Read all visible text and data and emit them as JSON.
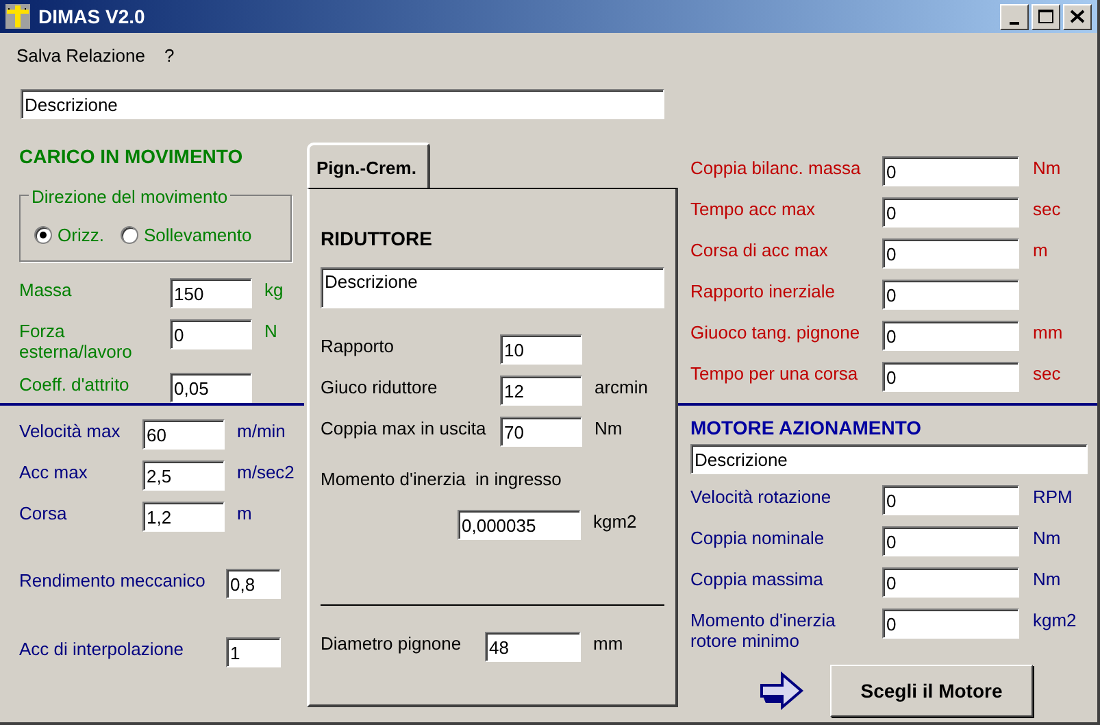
{
  "window": {
    "title": "DIMAS V2.0"
  },
  "menu": [
    {
      "label": "Salva Relazione"
    },
    {
      "label": "?"
    }
  ],
  "description": {
    "value": "Descrizione"
  },
  "load": {
    "heading": "CARICO IN MOVIMENTO",
    "direction": {
      "legend": "Direzione del movimento",
      "options": [
        {
          "label": "Orizz.",
          "selected": true
        },
        {
          "label": "Sollevamento",
          "selected": false
        }
      ]
    },
    "fields": [
      {
        "label": "Massa",
        "value": "150",
        "unit": "kg"
      },
      {
        "label": "Forza esterna/lavoro",
        "value": "0",
        "unit": "N"
      },
      {
        "label": "Coeff. d'attrito",
        "value": "0,05"
      }
    ]
  },
  "motion": {
    "fields": [
      {
        "label": "Velocità max",
        "value": "60",
        "unit": "m/min"
      },
      {
        "label": "Acc max",
        "value": "2,5",
        "unit": "m/sec2"
      },
      {
        "label": "Corsa",
        "value": "1,2",
        "unit": "m"
      }
    ],
    "efficiency": {
      "label": "Rendimento meccanico",
      "value": "0,8"
    },
    "interpolation": {
      "label": "Acc di interpolazione",
      "value": "1"
    }
  },
  "tabs": [
    {
      "label": "Pign.-Crem.",
      "selected": true
    }
  ],
  "reducer": {
    "heading": "RIDUTTORE",
    "description": "Descrizione",
    "fields": [
      {
        "label": "Rapporto",
        "value": "10"
      },
      {
        "label": "Giuco riduttore",
        "value": "12",
        "unit": "arcmin"
      },
      {
        "label": "Coppia max in uscita",
        "value": "70",
        "unit": "Nm"
      }
    ],
    "inertia": {
      "label": "Momento d'inerzia  in ingresso",
      "value": "0,000035",
      "unit": "kgm2"
    },
    "pinion": {
      "label": "Diametro pignone",
      "value": "48",
      "unit": "mm"
    }
  },
  "results": {
    "fields": [
      {
        "label": "Coppia bilanc. massa",
        "value": "0",
        "unit": "Nm"
      },
      {
        "label": "Tempo acc max",
        "value": "0",
        "unit": "sec"
      },
      {
        "label": "Corsa di acc max",
        "value": "0",
        "unit": "m"
      },
      {
        "label": "Rapporto inerziale",
        "value": "0"
      },
      {
        "label": "Giuoco tang. pignone",
        "value": "0",
        "unit": "mm"
      },
      {
        "label": "Tempo per una corsa",
        "value": "0",
        "unit": "sec"
      }
    ]
  },
  "motor": {
    "heading": "MOTORE AZIONAMENTO",
    "description": "Descrizione",
    "fields": [
      {
        "label": "Velocità rotazione",
        "value": "0",
        "unit": "RPM"
      },
      {
        "label": "Coppia nominale",
        "value": "0",
        "unit": "Nm"
      },
      {
        "label": "Coppia massima",
        "value": "0",
        "unit": "Nm"
      },
      {
        "label": "Momento d'inerzia rotore minimo",
        "value": "0",
        "unit": "kgm2"
      }
    ],
    "button": "Scegli il Motore"
  }
}
